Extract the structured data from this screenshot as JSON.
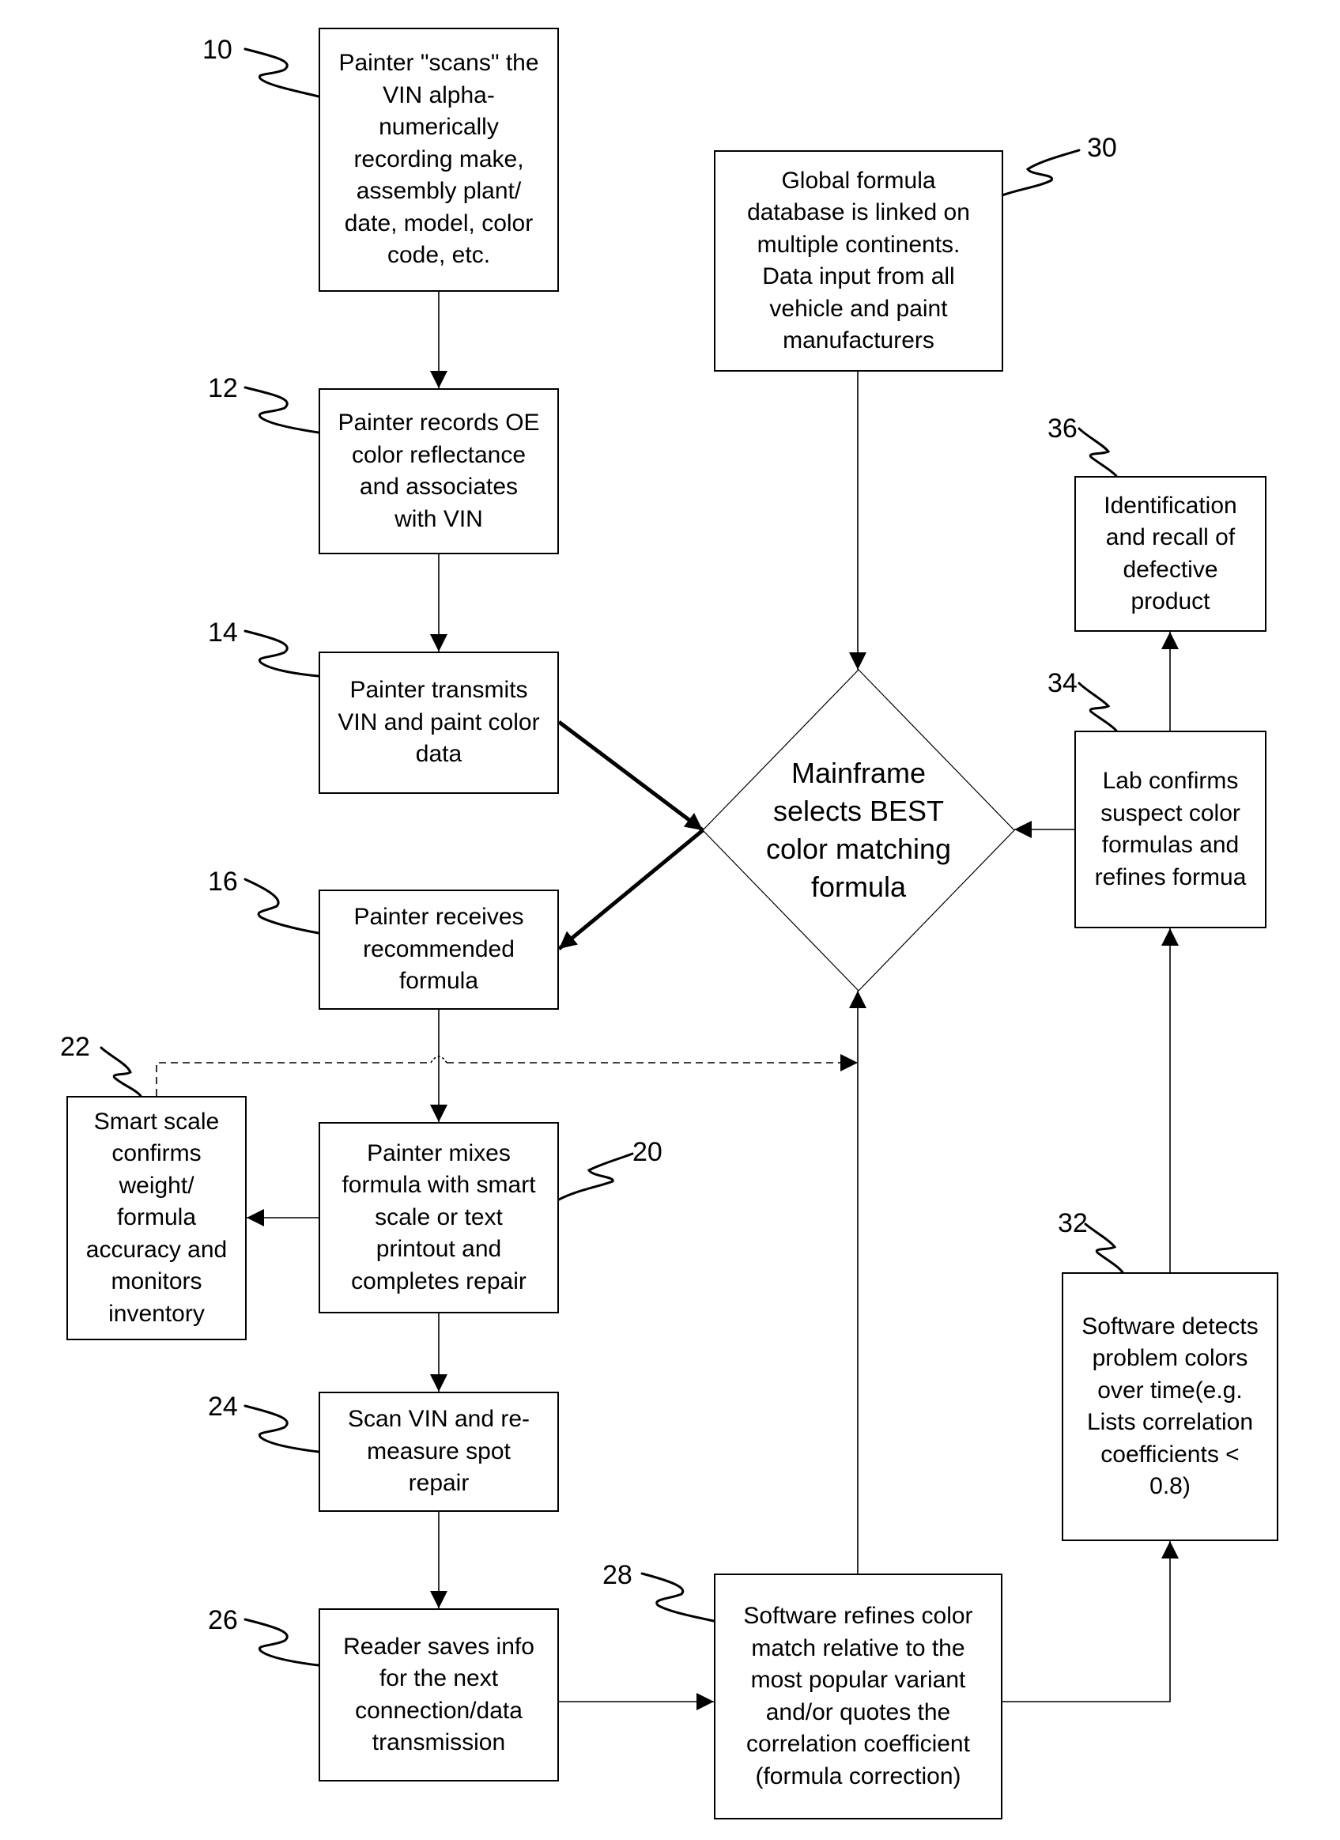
{
  "figure": {
    "colors": {
      "line": "#000000",
      "background": "#ffffff"
    },
    "steps": [
      {
        "id": "10",
        "ref": "10",
        "text": "Painter \"scans\" the VIN alpha-numerically recording make, assembly plant/ date, model, color code, etc.",
        "lines": [
          "Painter \"scans\" the",
          "VIN alpha-",
          "numerically",
          "recording make,",
          "assembly plant/",
          "date, model, color",
          "code, etc."
        ]
      },
      {
        "id": "12",
        "ref": "12",
        "lines": [
          "Painter records OE",
          "color reflectance",
          "and associates",
          "with VIN"
        ]
      },
      {
        "id": "14",
        "ref": "14",
        "lines": [
          "Painter transmits",
          "VIN and paint color",
          "data"
        ]
      },
      {
        "id": "16",
        "ref": "16",
        "lines": [
          "Painter receives",
          "recommended",
          "formula"
        ]
      },
      {
        "id": "20",
        "ref": "20",
        "lines": [
          "Painter mixes",
          "formula with smart",
          "scale or text",
          "printout and",
          "completes repair"
        ]
      },
      {
        "id": "22",
        "ref": "22",
        "lines": [
          "Smart scale",
          "confirms",
          "weight/",
          "formula",
          "accuracy and",
          "monitors",
          "inventory"
        ]
      },
      {
        "id": "24",
        "ref": "24",
        "lines": [
          "Scan VIN and re-",
          "measure spot",
          "repair"
        ]
      },
      {
        "id": "26",
        "ref": "26",
        "lines": [
          "Reader saves info",
          "for the next",
          "connection/data",
          "transmission"
        ]
      },
      {
        "id": "28",
        "ref": "28",
        "lines": [
          "Software refines color",
          "match relative to the",
          "most popular variant",
          "and/or quotes the",
          "correlation coefficient",
          "(formula correction)"
        ]
      },
      {
        "id": "30",
        "ref": "30",
        "lines": [
          "Global formula",
          "database is linked on",
          "multiple continents.",
          "Data input from all",
          "vehicle and paint",
          "manufacturers"
        ]
      },
      {
        "id": "32",
        "ref": "32",
        "lines": [
          "Software detects",
          "problem colors",
          "over time(e.g.",
          "Lists correlation",
          "coefficients <",
          "0.8)"
        ]
      },
      {
        "id": "34",
        "ref": "34",
        "lines": [
          "Lab confirms",
          "suspect color",
          "formulas and",
          "refines formua"
        ]
      },
      {
        "id": "36",
        "ref": "36",
        "lines": [
          "Identification",
          "and recall of",
          "defective",
          "product"
        ]
      }
    ],
    "decision": {
      "lines": [
        "Mainframe",
        "selects BEST",
        "color matching",
        "formula"
      ]
    },
    "connections": [
      {
        "from": "10",
        "to": "12",
        "style": "solid"
      },
      {
        "from": "12",
        "to": "14",
        "style": "solid"
      },
      {
        "from": "14",
        "to": "decision",
        "style": "bold"
      },
      {
        "from": "decision",
        "to": "16",
        "style": "bold"
      },
      {
        "from": "16",
        "to": "20",
        "style": "solid"
      },
      {
        "from": "20",
        "to": "22",
        "style": "solid"
      },
      {
        "from": "22",
        "to": "decision",
        "style": "dashed"
      },
      {
        "from": "20",
        "to": "24",
        "style": "solid"
      },
      {
        "from": "24",
        "to": "26",
        "style": "solid"
      },
      {
        "from": "26",
        "to": "28",
        "style": "solid"
      },
      {
        "from": "28",
        "to": "decision",
        "style": "solid"
      },
      {
        "from": "28",
        "to": "32",
        "style": "solid"
      },
      {
        "from": "32",
        "to": "34",
        "style": "solid"
      },
      {
        "from": "34",
        "to": "decision",
        "style": "solid"
      },
      {
        "from": "34",
        "to": "36",
        "style": "solid"
      },
      {
        "from": "30",
        "to": "decision",
        "style": "solid"
      }
    ]
  }
}
